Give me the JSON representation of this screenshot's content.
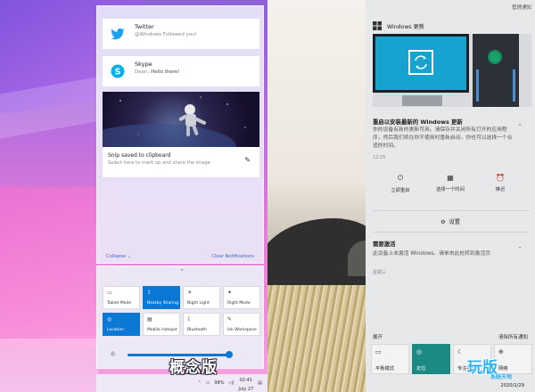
{
  "left": {
    "notifications": [
      {
        "app": "Twitter",
        "message": "@Windows Followed you!",
        "icon": "twitter-bird-icon"
      },
      {
        "app": "Skype",
        "sender": "Dean:",
        "message": "Hello there!",
        "icon": "skype-icon"
      }
    ],
    "snip": {
      "title": "Snip saved to clipboard",
      "subtitle": "Select here to mark up and share the image"
    },
    "collapse_label": "Collapse",
    "clear_label": "Clear Notifications",
    "quick_actions": [
      {
        "label": "Tablet Mode",
        "icon": "tablet-icon",
        "on": false
      },
      {
        "label": "Nearby Sharing",
        "icon": "share-icon",
        "on": true
      },
      {
        "label": "Night Light",
        "icon": "night-light-icon",
        "on": false
      },
      {
        "label": "Right Mode",
        "icon": "focus-icon",
        "on": false
      },
      {
        "label": "Location",
        "icon": "location-icon",
        "on": true
      },
      {
        "label": "Mobile Hotspot",
        "icon": "hotspot-icon",
        "on": false
      },
      {
        "label": "Bluetooth",
        "icon": "bluetooth-icon",
        "on": false
      },
      {
        "label": "Ink Workspace",
        "icon": "ink-icon",
        "on": false
      }
    ],
    "brightness": 0.82,
    "taskbar": {
      "battery": "98%",
      "time": "02:41",
      "date": "July 27"
    },
    "watermark": "概念版"
  },
  "right": {
    "manage": "管理通知",
    "update": {
      "header": "Windows 更新",
      "title": "重启以安装最新的 Windows 更新",
      "body": "你的设备有新的更新可用。请保存并关闭所有打开的应用程序，然后我们将在你不使用时重新启动，你也可以选择一个合适的时间。",
      "time": "12:25",
      "actions": [
        {
          "label": "立即重启",
          "icon": "power-icon"
        },
        {
          "label": "选择一个时间",
          "icon": "calendar-icon"
        },
        {
          "label": "推迟",
          "icon": "alarm-icon"
        }
      ]
    },
    "settings_label": "设置",
    "activation": {
      "title": "需要激活",
      "body": "此设备上未激活 Windows。请单击此处转到激活页",
      "time": "星期三"
    },
    "expand_label": "展开",
    "collapse_label": "清除所有通知",
    "quick_actions": [
      {
        "label": "平板模式",
        "icon": "tablet-icon",
        "on": false
      },
      {
        "label": "定位",
        "icon": "location-icon",
        "on": true
      },
      {
        "label": "专注模式",
        "icon": "moon-icon",
        "on": false
      },
      {
        "label": "网络",
        "icon": "network-icon",
        "on": false
      }
    ],
    "date": "2020/1/29",
    "watermark": "玩版",
    "watermark_sub": "系统天地"
  }
}
